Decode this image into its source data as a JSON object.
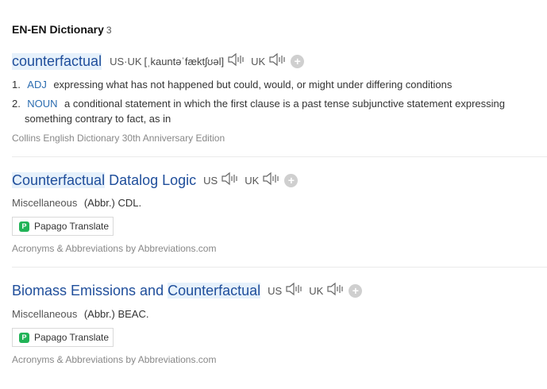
{
  "header": {
    "title": "EN-EN Dictionary",
    "count": "3"
  },
  "entries": [
    {
      "word": "counterfactual",
      "pron_us_uk_label": "US·UK",
      "pron_text": "[ˌkauntəˈfæktʃʊəl]",
      "uk_label": "UK",
      "definitions": [
        {
          "num": "1.",
          "pos": "ADJ",
          "text": "expressing what has not happened but could, would, or might under differing conditions"
        },
        {
          "num": "2.",
          "pos": "NOUN",
          "text_line1": "a conditional statement in which the first clause is a past tense subjunctive statement expressing",
          "text_line2": "something contrary to fact, as in"
        }
      ],
      "source": "Collins English Dictionary 30th Anniversary Edition"
    },
    {
      "word_hl": "Counterfactual",
      "word_rest": " Datalog Logic",
      "us_label": "US",
      "uk_label": "UK",
      "category": "Miscellaneous",
      "abbr": "(Abbr.) CDL.",
      "translate_label": "Papago Translate",
      "source": "Acronyms & Abbreviations by Abbreviations.com"
    },
    {
      "word_pre": "Biomass Emissions and ",
      "word_hl": "Counterfactual",
      "us_label": "US",
      "uk_label": "UK",
      "category": "Miscellaneous",
      "abbr": "(Abbr.) BEAC.",
      "translate_label": "Papago Translate",
      "source": "Acronyms & Abbreviations by Abbreviations.com"
    }
  ],
  "icons": {
    "speaker": "speaker-icon",
    "add": "plus-circle-icon",
    "papago": "papago-logo-icon"
  }
}
